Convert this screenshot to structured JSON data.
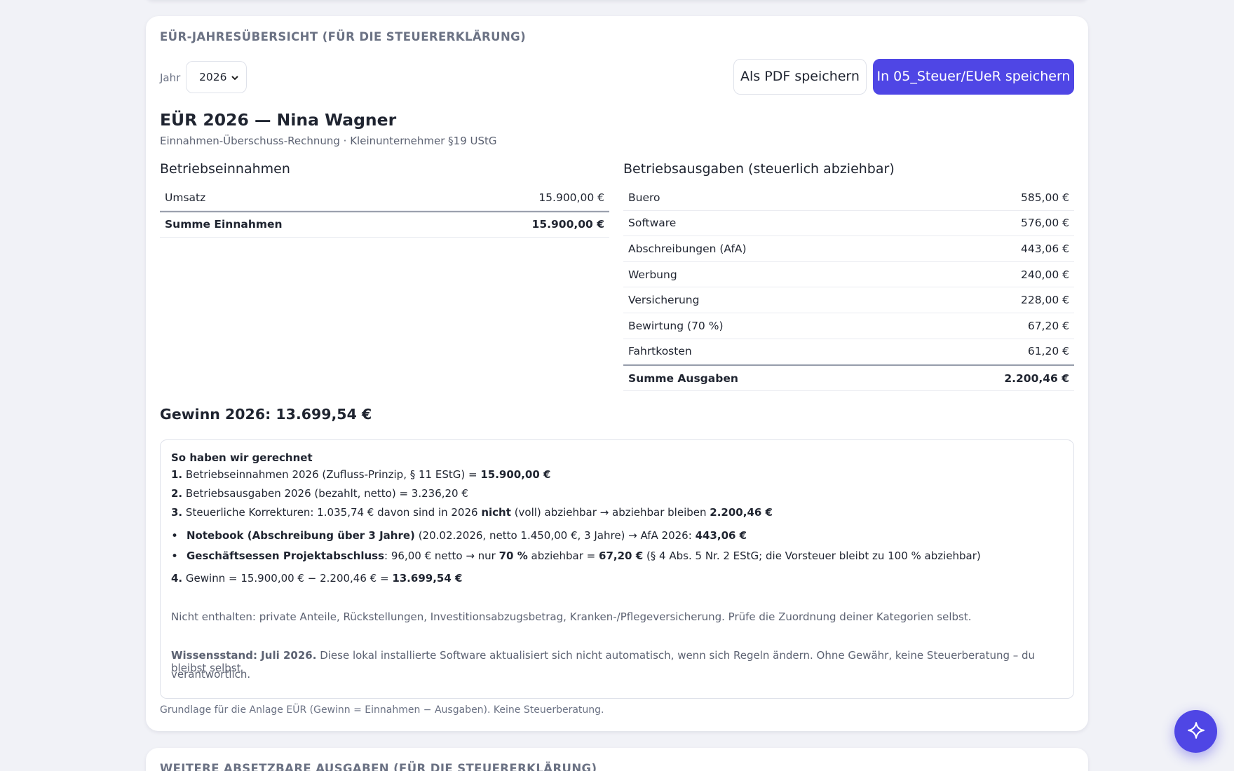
{
  "overview": {
    "section_title": "EÜR-Jahresübersicht (für die Steuererklärung)",
    "year_label": "Jahr",
    "year_value": "2026",
    "btn_pdf": "Als PDF speichern",
    "btn_save": "In 05_Steuer/EUeR speichern",
    "report_title": "EÜR 2026 — Nina Wagner",
    "report_sub": "Einnahmen-Überschuss-Rechnung · Kleinunternehmer §19 UStG"
  },
  "income": {
    "title": "Betriebseinnahmen",
    "rows": [
      {
        "label": "Umsatz",
        "amount": "15.900,00 €"
      }
    ],
    "sum_label": "Summe Einnahmen",
    "sum_amount": "15.900,00 €"
  },
  "expenses": {
    "title": "Betriebsausgaben (steuerlich abziehbar)",
    "rows": [
      {
        "label": "Buero",
        "amount": "585,00 €"
      },
      {
        "label": "Software",
        "amount": "576,00 €"
      },
      {
        "label": "Abschreibungen (AfA)",
        "amount": "443,06 €"
      },
      {
        "label": "Werbung",
        "amount": "240,00 €"
      },
      {
        "label": "Versicherung",
        "amount": "228,00 €"
      },
      {
        "label": "Bewirtung (70 %)",
        "amount": "67,20 €"
      },
      {
        "label": "Fahrtkosten",
        "amount": "61,20 €"
      }
    ],
    "sum_label": "Summe Ausgaben",
    "sum_amount": "2.200,46 €"
  },
  "profit": "Gewinn 2026: 13.699,54 €",
  "calc": {
    "heading": "So haben wir gerechnet",
    "step1_num": "1.",
    "step1_text": "Betriebseinnahmen 2026 (Zufluss-Prinzip, § 11 EStG) =",
    "step1_value": "15.900,00 €",
    "step2_num": "2.",
    "step2_text": "Betriebsausgaben 2026 (bezahlt, netto) = 3.236,20 €",
    "step3_num": "3.",
    "step3_text_a": "Steuerliche Korrekturen: 1.035,74 € davon sind in 2026",
    "step3_bold": "nicht",
    "step3_text_b": "(voll) abziehbar → abziehbar bleiben",
    "step3_value": "2.200,46 €",
    "bullet1_bold": "Notebook (Abschreibung über 3 Jahre)",
    "bullet1_text": "(20.02.2026, netto 1.450,00 €, 3 Jahre) → AfA 2026:",
    "bullet1_value": "443,06 €",
    "bullet2_bold": "Geschäftsessen Projektabschluss",
    "bullet2_text_a": ": 96,00 € netto → nur",
    "bullet2_pct": "70 %",
    "bullet2_text_b": "abziehbar =",
    "bullet2_value": "67,20 €",
    "bullet2_text_c": "(§ 4 Abs. 5 Nr. 2 EStG; die Vorsteuer bleibt zu 100 % abziehbar)",
    "step4_num": "4.",
    "step4_text": "Gewinn = 15.900,00 € − 2.200,46 € =",
    "step4_value": "13.699,54 €",
    "not_included": "Nicht enthalten: private Anteile, Rückstellungen, Investitionsabzugsbetrag, Kranken-/Pflegeversicherung. Prüfe die Zuordnung deiner Kategorien selbst.",
    "knowledge_bold": "Wissensstand: Juli 2026.",
    "knowledge_text": "Diese lokal installierte Software aktualisiert sich nicht automatisch, wenn sich Regeln ändern. Ohne Gewähr, keine Steuerberatung – du bleibst selbst",
    "knowledge_text2": "verantwortlich."
  },
  "footer_note": "Grundlage für die Anlage EÜR (Gewinn = Einnahmen − Ausgaben). Keine Steuerberatung.",
  "next_section_title": "Weitere absetzbare Ausgaben (für die Steuererklärung)",
  "icons": {
    "fab": "sparkle-icon",
    "select": "chevron-down-icon"
  },
  "colors": {
    "accent": "#4f46e5",
    "background": "#f1f2f7",
    "muted": "#6b7284"
  }
}
